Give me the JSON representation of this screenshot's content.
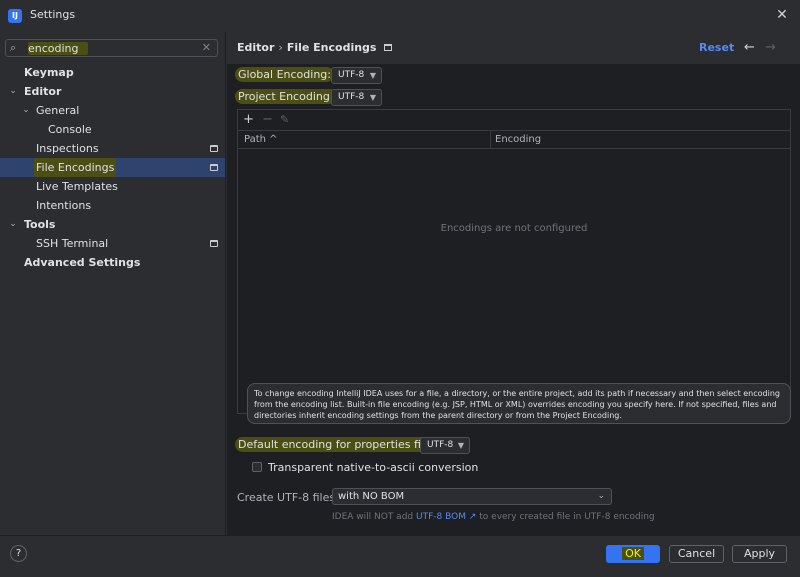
{
  "window": {
    "title": "Settings",
    "app_icon_text": "IJ"
  },
  "search": {
    "value": "encoding",
    "placeholder": ""
  },
  "sidebar": {
    "items": [
      {
        "label": "Keymap"
      },
      {
        "label": "Editor"
      },
      {
        "label": "General"
      },
      {
        "label": "Console"
      },
      {
        "label": "Inspections"
      },
      {
        "label": "File Encodings"
      },
      {
        "label": "Live Templates"
      },
      {
        "label": "Intentions"
      },
      {
        "label": "Tools"
      },
      {
        "label": "SSH Terminal"
      },
      {
        "label": "Advanced Settings"
      }
    ]
  },
  "header": {
    "crumb_parent": "Editor",
    "crumb_sep": "›",
    "crumb_current": "File Encodings",
    "reset_label": "Reset"
  },
  "form": {
    "global_label": "Global Encoding:",
    "global_value": "UTF-8",
    "project_label": "Project Encoding:",
    "project_value": "UTF-8",
    "table": {
      "columns": [
        "Path",
        "Encoding"
      ],
      "sort_indicator": "^",
      "empty_text": "Encodings are not configured"
    },
    "help_text": "To change encoding IntelliJ IDEA uses for a file, a directory, or the entire project, add its path if necessary and then select encoding from the encoding list. Built-in file encoding (e.g. JSP, HTML or XML) overrides encoding you specify here. If not specified, files and directories inherit encoding settings from the parent directory or from the Project Encoding.",
    "properties_label": "Default encoding for properties files:",
    "properties_value": "UTF-8",
    "transparent_label": "Transparent native-to-ascii conversion",
    "transparent_checked": false,
    "utf8_label": "Create UTF-8 files:",
    "utf8_value": "with NO BOM",
    "note_before": "IDEA will NOT add",
    "note_link": "UTF-8 BOM ↗",
    "note_after": "to every created file in UTF-8 encoding"
  },
  "footer": {
    "ok_label": "OK",
    "cancel_label": "Cancel",
    "apply_label": "Apply",
    "help_label": "?"
  },
  "colors": {
    "accent": "#3574f0",
    "link": "#548af7",
    "selection": "#2e436e",
    "search_highlight": "#4c4f14"
  }
}
